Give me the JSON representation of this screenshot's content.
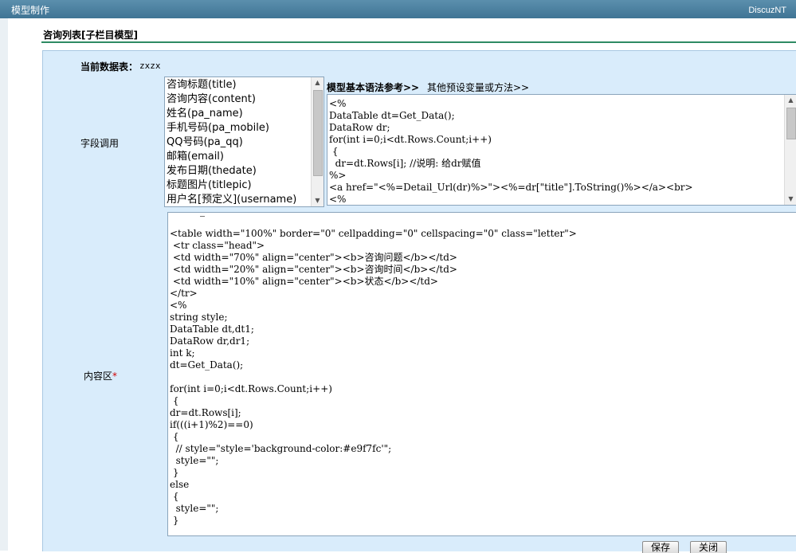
{
  "window": {
    "title": "模型制作",
    "brand": "DiscuzNT"
  },
  "section_title": "咨询列表[子栏目模型]",
  "form": {
    "table_label": "当前数据表：",
    "table_value": "zxzx",
    "field_label": "字段调用",
    "content_label": "内容区",
    "required_mark": "*"
  },
  "field_list": [
    "咨询标题(title)",
    "咨询内容(content)",
    "姓名(pa_name)",
    "手机号码(pa_mobile)",
    "QQ号码(pa_qq)",
    "邮箱(email)",
    "发布日期(thedate)",
    "标题图片(titlepic)",
    "用户名[预定义](username)"
  ],
  "syntax_links": {
    "basic": "模型基本语法参考>>",
    "other": "其他预设变量或方法>>"
  },
  "syntax_code": "<%\nDataTable dt=Get_Data();\nDataRow dr;\nfor(int i=0;i<dt.Rows.Count;i++)\n {\n  dr=dt.Rows[i]; //说明: 给dr赋值\n%>\n<a href=\"<%=Detail_Url(dr)%>\"><%=dr[\"title\"].ToString()%></a><br>\n<%",
  "content_code": "<table width=\"100%\" border=\"0\" cellpadding=\"0\" cellspacing=\"0\" class=\"letter\">\n <tr class=\"head\">\n <td width=\"70%\" align=\"center\"><b>咨询问题</b></td>\n <td width=\"20%\" align=\"center\"><b>咨询时间</b></td>\n <td width=\"10%\" align=\"center\"><b>状态</b></td>\n</tr>\n<%\nstring style;\nDataTable dt,dt1;\nDataRow dr,dr1;\nint k;\ndt=Get_Data();\n\nfor(int i=0;i<dt.Rows.Count;i++)\n {\ndr=dt.Rows[i];\nif(((i+1)%2)==0)\n {\n  // style=\"style='background-color:#e9f7fc'\";\n  style=\"\";\n }\nelse\n {\n  style=\"\";\n }",
  "buttons": {
    "save": "保存",
    "close": "关闭"
  },
  "icons": {
    "scroll_up": "scroll-up-arrow-icon",
    "scroll_down": "scroll-down-arrow-icon"
  },
  "colors": {
    "titlebar": "#4a7fa0",
    "panel": "#d9ecfb",
    "divider": "#2e8a63",
    "required": "#d00000"
  }
}
